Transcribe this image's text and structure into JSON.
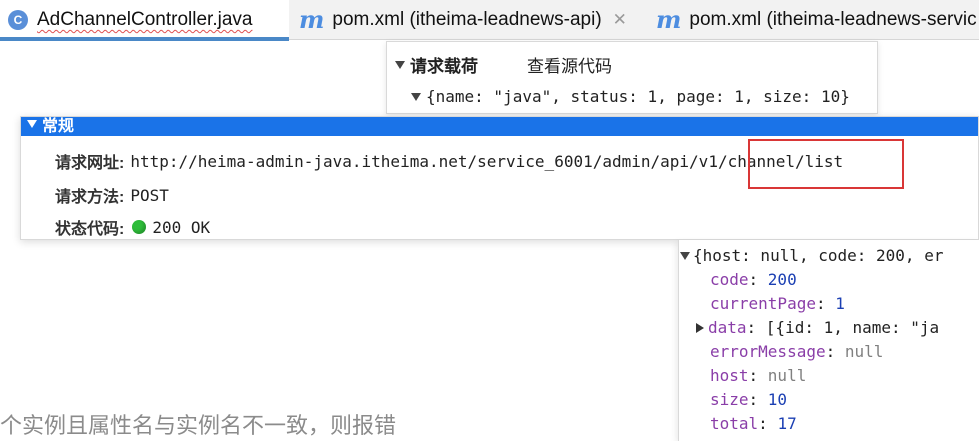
{
  "tabs": [
    {
      "label": "AdChannelController.java",
      "icon": "java-class-icon",
      "active": true
    },
    {
      "label": "pom.xml (itheima-leadnews-api)",
      "icon": "maven-icon",
      "active": false
    },
    {
      "label": "pom.xml (itheima-leadnews-servic",
      "icon": "maven-icon",
      "active": false
    }
  ],
  "payload": {
    "title": "请求载荷",
    "view_source": "查看源代码",
    "body": "{name: \"java\", status: 1, page: 1, size: 10}"
  },
  "general": {
    "title": "常规",
    "url_label": "请求网址:",
    "url_value": "http://heima-admin-java.itheima.net/service_6001/admin/api/v1/channel/list",
    "method_label": "请求方法:",
    "method_value": "POST",
    "status_label": "状态代码:",
    "status_value": "200 OK",
    "status_color": "#2ebd3a"
  },
  "response": {
    "summary": "{host: null, code: 200, er",
    "fields": [
      {
        "key": "code",
        "value": "200",
        "kind": "num"
      },
      {
        "key": "currentPage",
        "value": "1",
        "kind": "num"
      },
      {
        "key": "data",
        "value": "[{id: 1, name: \"ja",
        "kind": "str",
        "expandable": true
      },
      {
        "key": "errorMessage",
        "value": "null",
        "kind": "null"
      },
      {
        "key": "host",
        "value": "null",
        "kind": "null"
      },
      {
        "key": "size",
        "value": "10",
        "kind": "num"
      },
      {
        "key": "total",
        "value": "17",
        "kind": "num"
      }
    ]
  },
  "background_text": "个实例且属性名与实例名不一致，则报错",
  "colors": {
    "accent_blue": "#1a73e8",
    "highlight_red": "#d93636",
    "json_key": "#8a3ea8",
    "json_number": "#1b3fb3"
  }
}
